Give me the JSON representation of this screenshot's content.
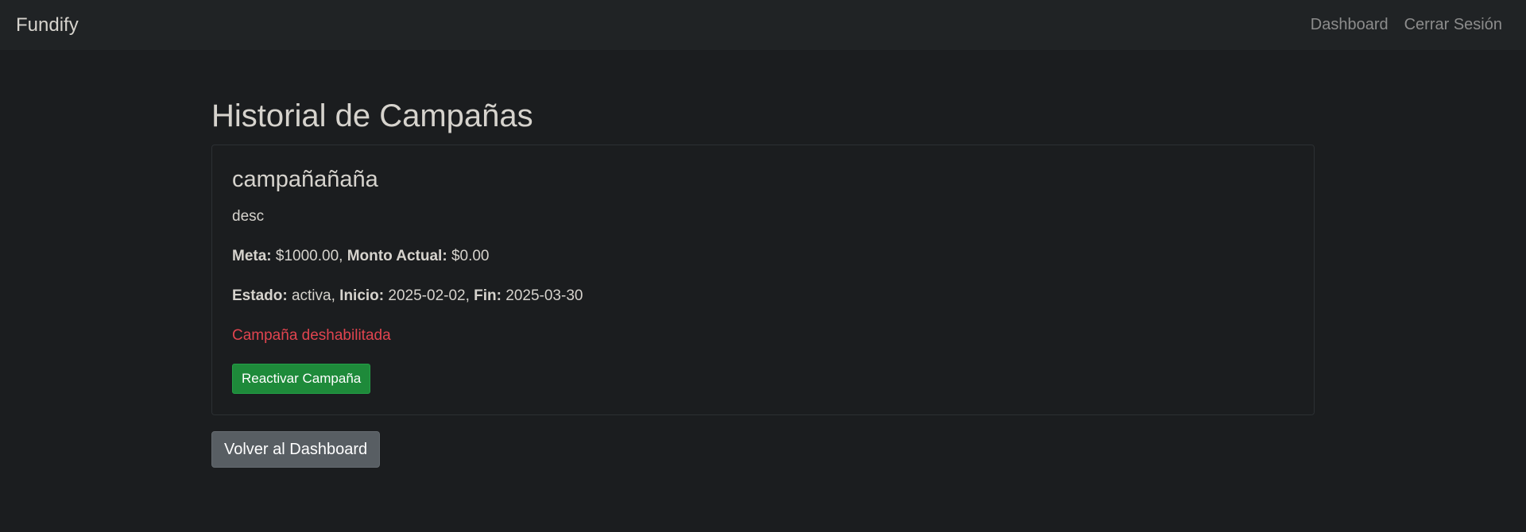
{
  "navbar": {
    "brand": "Fundify",
    "links": [
      {
        "label": "Dashboard"
      },
      {
        "label": "Cerrar Sesión"
      }
    ]
  },
  "page": {
    "title": "Historial de Campañas"
  },
  "campaign": {
    "name": "campañañaña",
    "description": "desc",
    "meta_label": "Meta:",
    "meta_value": " $1000.00, ",
    "monto_label": "Monto Actual:",
    "monto_value": " $0.00",
    "estado_label": "Estado:",
    "estado_value": " activa, ",
    "inicio_label": "Inicio:",
    "inicio_value": " 2025-02-02, ",
    "fin_label": "Fin:",
    "fin_value": " 2025-03-30",
    "status_message": "Campaña deshabilitada",
    "reactivate_label": "Reactivar Campaña"
  },
  "actions": {
    "back_label": "Volver al Dashboard"
  },
  "colors": {
    "background": "#1b1d1f",
    "navbar": "#202325",
    "danger_text": "#e0444f",
    "success_button": "#1e8a3a",
    "secondary_button": "#585e63"
  }
}
